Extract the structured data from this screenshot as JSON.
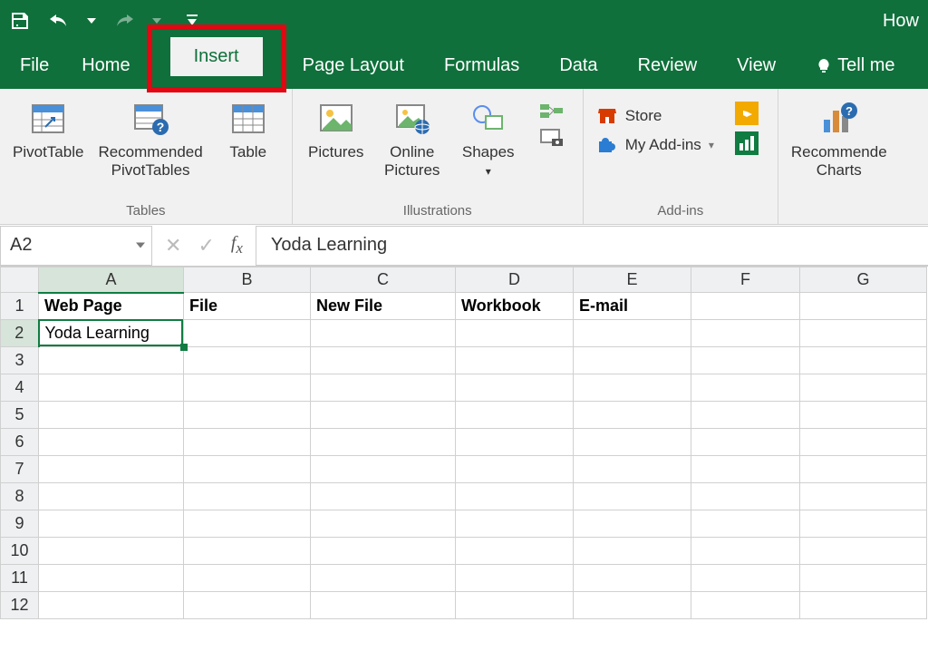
{
  "title_right": "How",
  "tabs": {
    "file": "File",
    "home": "Home",
    "insert": "Insert",
    "page_layout": "Page Layout",
    "formulas": "Formulas",
    "data": "Data",
    "review": "Review",
    "view": "View",
    "tell_me": "Tell me"
  },
  "ribbon": {
    "tables": {
      "pivottable": "PivotTable",
      "rec_pt_1": "Recommended",
      "rec_pt_2": "PivotTables",
      "table": "Table",
      "group": "Tables"
    },
    "illustrations": {
      "pictures": "Pictures",
      "online_1": "Online",
      "online_2": "Pictures",
      "shapes": "Shapes",
      "group": "Illustrations"
    },
    "addins": {
      "store": "Store",
      "myaddins": "My Add-ins",
      "group": "Add-ins"
    },
    "charts": {
      "rec_1": "Recommende",
      "rec_2": "Charts"
    }
  },
  "namebox": "A2",
  "formula_value": "Yoda Learning",
  "columns": [
    "A",
    "B",
    "C",
    "D",
    "E",
    "F",
    "G"
  ],
  "rows": [
    "1",
    "2",
    "3",
    "4",
    "5",
    "6",
    "7",
    "8",
    "9",
    "10",
    "11",
    "12"
  ],
  "cells": {
    "A1": "Web Page",
    "B1": "File",
    "C1": "New File",
    "D1": "Workbook",
    "E1": "E-mail",
    "A2": "Yoda Learning"
  },
  "active_cell": "A2"
}
